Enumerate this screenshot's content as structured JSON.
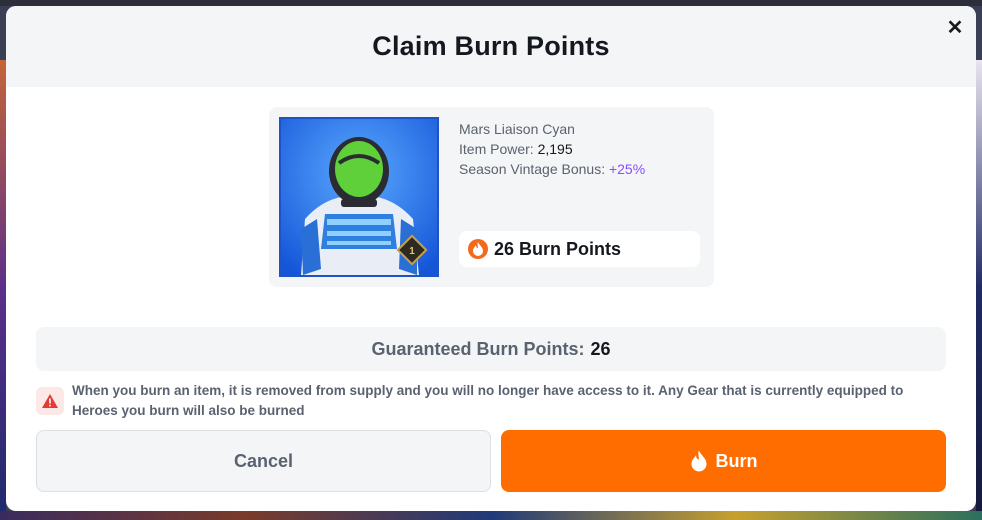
{
  "modal": {
    "title": "Claim Burn Points",
    "close_glyph": "✕"
  },
  "item": {
    "name": "Mars Liaison Cyan",
    "power_label": "Item Power:",
    "power_value": "2,195",
    "bonus_label": "Season Vintage Bonus:",
    "bonus_value": "+25%",
    "level_badge": "1",
    "burn_points": "26 Burn Points"
  },
  "guaranteed": {
    "label": "Guaranteed Burn Points:",
    "value": "26"
  },
  "warning": {
    "text": "When you burn an item, it is removed from supply and you will no longer have access to it. Any Gear that is currently equipped to Heroes you burn will also be burned",
    "icon": "warning-triangle-icon"
  },
  "actions": {
    "cancel_label": "Cancel",
    "burn_label": "Burn"
  },
  "colors": {
    "accent": "#ff6d00",
    "bonus": "#8b4dff",
    "warning": "#e53935"
  }
}
